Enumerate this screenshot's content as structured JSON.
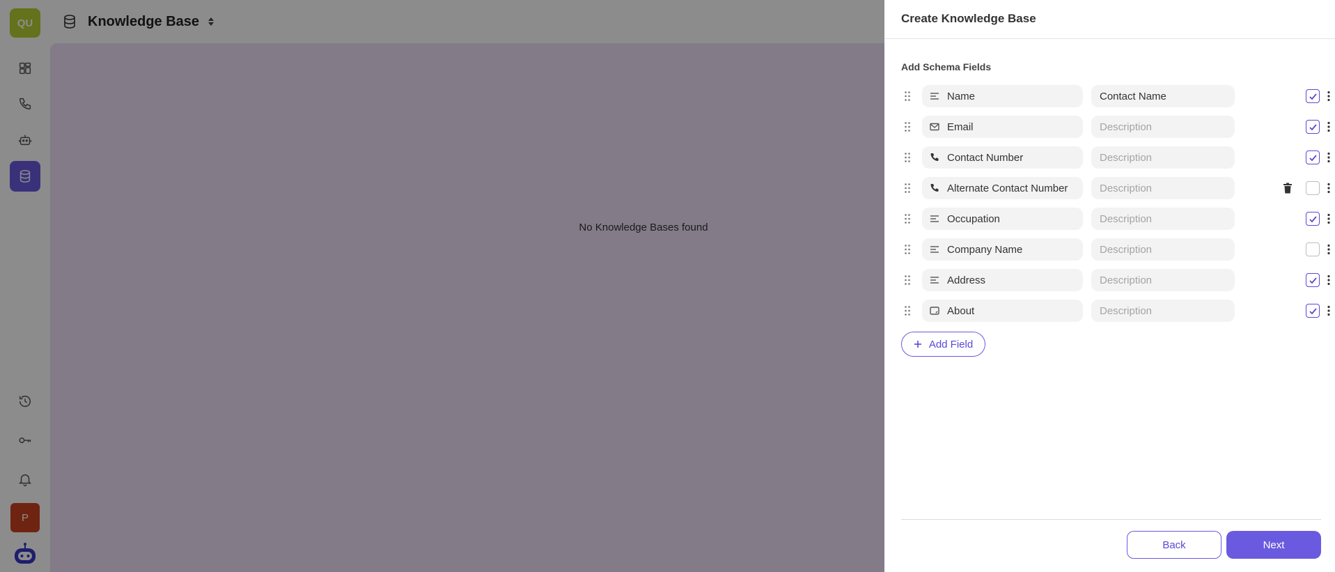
{
  "colors": {
    "accent": "#6a5ae0",
    "accent_dark": "#5a48d6",
    "avatar_qu": "#b4cf32",
    "avatar_p": "#c9421f",
    "main_bg": "#efe2f7",
    "nav_active_bg": "#6a5ae0"
  },
  "sidebar": {
    "avatar_initials": "QU",
    "profile_initial": "P",
    "items": [
      {
        "name": "dashboard",
        "icon": "grid-icon",
        "active": false
      },
      {
        "name": "calls",
        "icon": "phone-icon",
        "active": false
      },
      {
        "name": "agents",
        "icon": "robot-icon",
        "active": false
      },
      {
        "name": "knowledge-base",
        "icon": "database-icon",
        "active": true
      },
      {
        "name": "history",
        "icon": "history-icon",
        "active": false
      },
      {
        "name": "api-keys",
        "icon": "key-icon",
        "active": false
      },
      {
        "name": "notifications",
        "icon": "bell-icon",
        "active": false
      }
    ]
  },
  "header": {
    "title": "Knowledge Base"
  },
  "main": {
    "empty_message": "No Knowledge Bases found"
  },
  "drawer": {
    "title": "Create Knowledge Base",
    "section_label": "Add Schema Fields",
    "fields": [
      {
        "name": "Name",
        "icon": "text-lines-icon",
        "description": "Contact Name",
        "description_placeholder": "Description",
        "checked": true,
        "deletable": false
      },
      {
        "name": "Email",
        "icon": "mail-icon",
        "description": "",
        "description_placeholder": "Description",
        "checked": true,
        "deletable": false
      },
      {
        "name": "Contact Number",
        "icon": "phone-icon",
        "description": "",
        "description_placeholder": "Description",
        "checked": true,
        "deletable": false
      },
      {
        "name": "Alternate Contact Number",
        "icon": "phone-icon",
        "description": "",
        "description_placeholder": "Description",
        "checked": false,
        "deletable": true
      },
      {
        "name": "Occupation",
        "icon": "text-lines-icon",
        "description": "",
        "description_placeholder": "Description",
        "checked": true,
        "deletable": false
      },
      {
        "name": "Company Name",
        "icon": "text-lines-icon",
        "description": "",
        "description_placeholder": "Description",
        "checked": false,
        "deletable": false
      },
      {
        "name": "Address",
        "icon": "text-lines-icon",
        "description": "",
        "description_placeholder": "Description",
        "checked": true,
        "deletable": false
      },
      {
        "name": "About",
        "icon": "textarea-icon",
        "description": "",
        "description_placeholder": "Description",
        "checked": true,
        "deletable": false
      }
    ],
    "add_field_label": "Add Field",
    "back_label": "Back",
    "next_label": "Next"
  }
}
